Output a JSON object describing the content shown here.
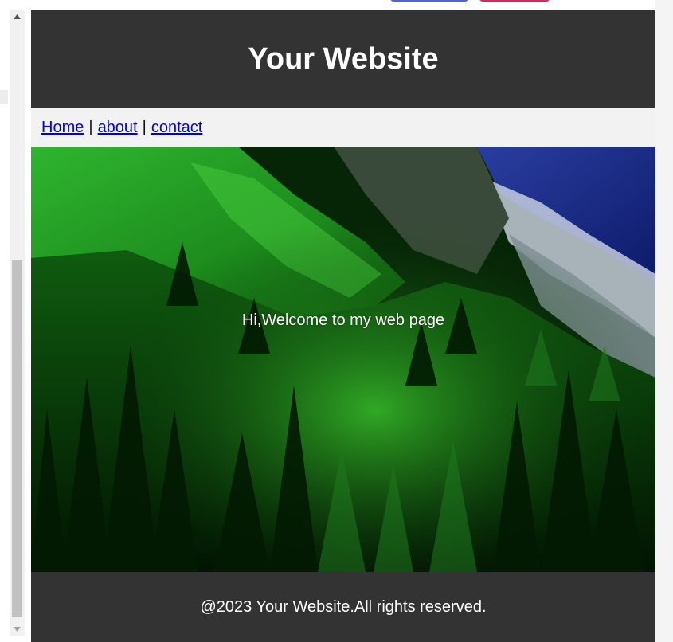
{
  "header": {
    "title": "Your Website"
  },
  "nav": {
    "items": [
      {
        "label": "Home"
      },
      {
        "label": "about"
      },
      {
        "label": "contact"
      }
    ],
    "separator": "|"
  },
  "hero": {
    "text": "Hi,Welcome to my web page"
  },
  "footer": {
    "text": "@2023 Your Website.All rights reserved."
  },
  "icons": {
    "scroll_up": "triangle-up-icon",
    "scroll_down": "triangle-down-icon"
  },
  "colors": {
    "header_bg": "#333333",
    "nav_bg": "#f2f2f2",
    "link": "#0000ee",
    "footer_bg": "#333333",
    "text_light": "#ffffff"
  }
}
